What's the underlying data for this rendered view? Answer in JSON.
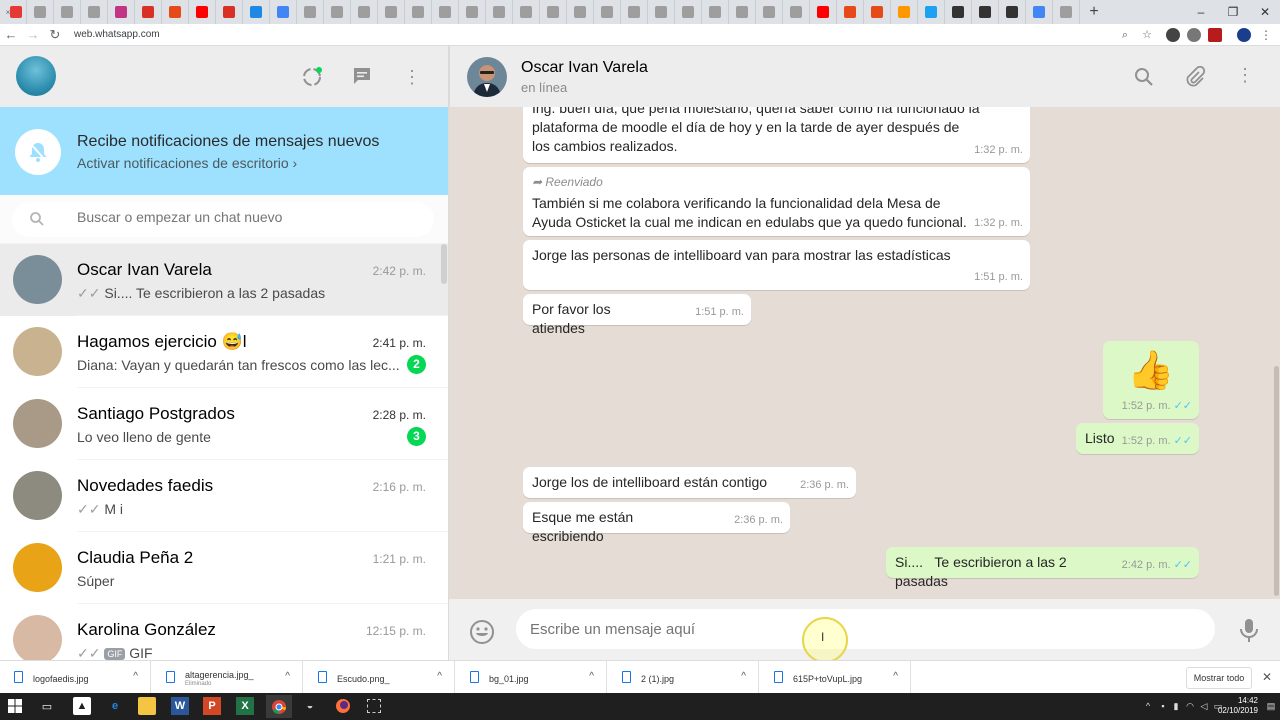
{
  "browser": {
    "url": "web.whatsapp.com",
    "tab_colors": [
      "#e53935",
      "#9e9e9e",
      "#9e9e9e",
      "#9e9e9e",
      "#c13584",
      "#d93025",
      "#e64a19",
      "#ff0000",
      "#d93025",
      "#1e88e5",
      "#4285f4",
      "#9e9e9e",
      "#9e9e9e",
      "#9e9e9e",
      "#9e9e9e",
      "#9e9e9e",
      "#9e9e9e",
      "#9e9e9e",
      "#9e9e9e",
      "#9e9e9e",
      "#9e9e9e",
      "#9e9e9e",
      "#9e9e9e",
      "#9e9e9e",
      "#9e9e9e",
      "#9e9e9e",
      "#9e9e9e",
      "#9e9e9e",
      "#9e9e9e",
      "#9e9e9e",
      "#ff0000",
      "#e64a19",
      "#e64a19",
      "#ff9800",
      "#1da1f2",
      "#333333",
      "#333333",
      "#333333",
      "#4285f4",
      "#9e9e9e"
    ]
  },
  "sidebar": {
    "notification": {
      "title": "Recibe notificaciones de mensajes nuevos",
      "link": "Activar notificaciones de escritorio ›"
    },
    "search_placeholder": "Buscar o empezar un chat nuevo",
    "chats": [
      {
        "name": "Oscar Ivan Varela",
        "time": "2:42 p. m.",
        "ticks": "✓✓",
        "preview": "Si.... Te escribieron a las 2 pasadas",
        "unread": "",
        "avatar": "#7a8e9a"
      },
      {
        "name": "Hagamos ejercicio 😅l",
        "time": "2:41 p. m.",
        "ticks": "",
        "preview": "Diana: Vayan y quedarán tan frescos como las lec...",
        "unread": "2",
        "avatar": "#c9b28f"
      },
      {
        "name": "Santiago Postgrados",
        "time": "2:28 p. m.",
        "ticks": "",
        "preview": "Lo veo lleno de gente",
        "unread": "3",
        "avatar": "#a89a86"
      },
      {
        "name": "Novedades faedis",
        "time": "2:16 p. m.",
        "ticks": "✓✓",
        "preview": "M i",
        "unread": "",
        "avatar": "#8d8a7f"
      },
      {
        "name": "Claudia Peña 2",
        "time": "1:21 p. m.",
        "ticks": "",
        "preview": "Súper",
        "unread": "",
        "avatar": "#e8a317"
      },
      {
        "name": "Karolina González",
        "time": "12:15 p. m.",
        "ticks": "✓✓",
        "preview": "GIF",
        "unread": "",
        "avatar": "#d8b9a4"
      }
    ],
    "gif_label": "GIF"
  },
  "conversation": {
    "contact_name": "Oscar Ivan Varela",
    "contact_status": "en línea",
    "messages": [
      {
        "dir": "in",
        "text": "Ing. buen día, que pena molestarlo, quería saber como ha funcionado la plataforma de moodle el día de hoy y en la tarde de ayer después de los cambios realizados.",
        "time": "1:32 p. m."
      },
      {
        "dir": "in",
        "forwarded": "Reenviado",
        "text": "También si me colabora verificando la funcionalidad dela Mesa de Ayuda Osticket la cual me indican en edulabs que ya quedo funcional.",
        "time": "1:32 p. m."
      },
      {
        "dir": "in",
        "text": "Jorge las personas de intelliboard van para mostrar las estadísticas",
        "time": "1:51 p. m."
      },
      {
        "dir": "in",
        "text": "Por favor los atiendes",
        "time": "1:51 p. m."
      },
      {
        "dir": "out",
        "text": "👍",
        "time": "1:52 p. m.",
        "ticks": "✓✓"
      },
      {
        "dir": "out",
        "text": "Listo",
        "time": "1:52 p. m.",
        "ticks": "✓✓"
      },
      {
        "dir": "in",
        "text": "Jorge los de intelliboard están contigo",
        "time": "2:36 p. m."
      },
      {
        "dir": "in",
        "text": "Esque me están escribiendo",
        "time": "2:36 p. m."
      },
      {
        "dir": "out",
        "text": "Si....   Te escribieron a las 2 pasadas",
        "time": "2:42 p. m.",
        "ticks": "✓✓"
      }
    ],
    "composer_placeholder": "Escribe un mensaje aquí"
  },
  "downloads": {
    "items": [
      {
        "name": "logofaedis.jpg",
        "sub": ""
      },
      {
        "name": "altagerencia.jpg_",
        "sub": "Eliminado"
      },
      {
        "name": "Escudo.png_",
        "sub": ""
      },
      {
        "name": "bg_01.jpg",
        "sub": ""
      },
      {
        "name": "2 (1).jpg",
        "sub": ""
      },
      {
        "name": "615P+toVupL.jpg",
        "sub": ""
      }
    ],
    "show_all": "Mostrar todo"
  },
  "taskbar": {
    "time": "14:42",
    "date": "02/10/2019"
  },
  "colors": {
    "accent_green": "#06d755",
    "notif_bg": "#9de1fe",
    "chat_bg": "#e5ddd5",
    "out_bubble": "#dcf8c6",
    "read_tick": "#4fc3f7"
  }
}
